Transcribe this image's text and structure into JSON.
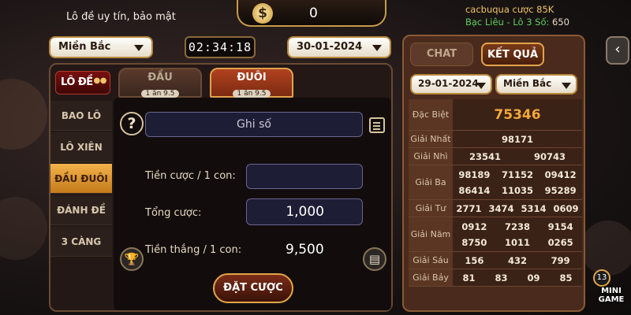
{
  "header": {
    "ticker": "Lô đề uy tín, bảo mật",
    "balance": "0",
    "currency_symbol": "$",
    "recent_user": "cacbuqua cược 85K",
    "recent_bet_label": "Bạc Liêu - Lô 3 Số:",
    "recent_bet_value": "650"
  },
  "controls": {
    "region": "Miền Bắc",
    "countdown": "02:34:18",
    "date": "30-01-2024"
  },
  "game": {
    "logo_text": "LÔ ĐỀ",
    "top_tabs": [
      {
        "label": "ĐẦU",
        "ratio": "1 ăn 9.5",
        "active": false
      },
      {
        "label": "ĐUÔI",
        "ratio": "1 ăn 9.5",
        "active": true
      }
    ],
    "side_tabs": [
      {
        "label": "BAO LÔ",
        "active": false
      },
      {
        "label": "LÔ XIÊN",
        "active": false
      },
      {
        "label": "ĐẦU ĐUÔI",
        "active": true
      },
      {
        "label": "ĐÁNH ĐỀ",
        "active": false
      },
      {
        "label": "3 CÀNG",
        "active": false
      }
    ],
    "help_icon": "?",
    "numbers_placeholder": "Ghi số",
    "stake_label": "Tiền cược / 1 con:",
    "stake_value": "",
    "total_label": "Tổng cược:",
    "total_value": "1,000",
    "win_label": "Tiền thắng / 1 con:",
    "win_value": "9,500",
    "bet_button": "ĐẶT CƯỢC"
  },
  "results": {
    "tabs": {
      "chat": "CHAT",
      "results": "KẾT QUẢ"
    },
    "date": "29-01-2024",
    "region": "Miền Bắc",
    "rows": [
      {
        "name": "Đặc Biệt",
        "cols": 1,
        "values": [
          "75346"
        ]
      },
      {
        "name": "Giải Nhất",
        "cols": 1,
        "values": [
          "98171"
        ]
      },
      {
        "name": "Giải Nhì",
        "cols": 2,
        "values": [
          "23541",
          "90743"
        ]
      },
      {
        "name": "Giải Ba",
        "cols": 3,
        "values": [
          "98189",
          "71152",
          "09412",
          "86414",
          "11035",
          "95289"
        ]
      },
      {
        "name": "Giải Tư",
        "cols": 4,
        "values": [
          "2771",
          "3474",
          "5314",
          "0609"
        ]
      },
      {
        "name": "Giải Năm",
        "cols": 3,
        "values": [
          "0912",
          "7238",
          "9154",
          "8750",
          "1011",
          "0265"
        ]
      },
      {
        "name": "Giải Sáu",
        "cols": 3,
        "values": [
          "156",
          "432",
          "799"
        ]
      },
      {
        "name": "Giải Bảy",
        "cols": 4,
        "values": [
          "81",
          "83",
          "09",
          "85"
        ]
      }
    ]
  },
  "side": {
    "back_icon": "‹",
    "minigame_count": "13",
    "minigame_label": "MINI GAME"
  },
  "colors": {
    "accent_gold": "#e3a54a",
    "special_prize": "#f4a73a",
    "active_tab": "#c57a1b"
  }
}
